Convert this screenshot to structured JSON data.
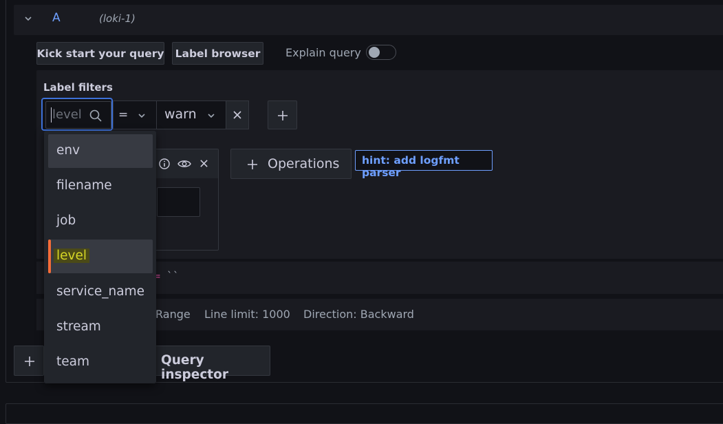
{
  "query": {
    "letter": "A",
    "datasource": "(loki-1)"
  },
  "toolbar": {
    "kick_start": "Kick start your query",
    "label_browser": "Label browser",
    "explain_query": "Explain query"
  },
  "label_filters": {
    "title": "Label filters",
    "label_value": "level",
    "operator": "=",
    "value": "warn"
  },
  "operations": {
    "button_label": "Operations",
    "hint": "hint: add logfmt parser"
  },
  "code": {
    "eq": "=",
    "value": "``"
  },
  "options": {
    "range": "Range",
    "line_limit": "Line limit: 1000",
    "direction": "Direction: Backward"
  },
  "footer": {
    "query_inspector": "Query inspector"
  },
  "dropdown": {
    "items": [
      "env",
      "filename",
      "job",
      "level",
      "service_name",
      "stream",
      "team"
    ],
    "hovered": "env",
    "selected": "level"
  }
}
